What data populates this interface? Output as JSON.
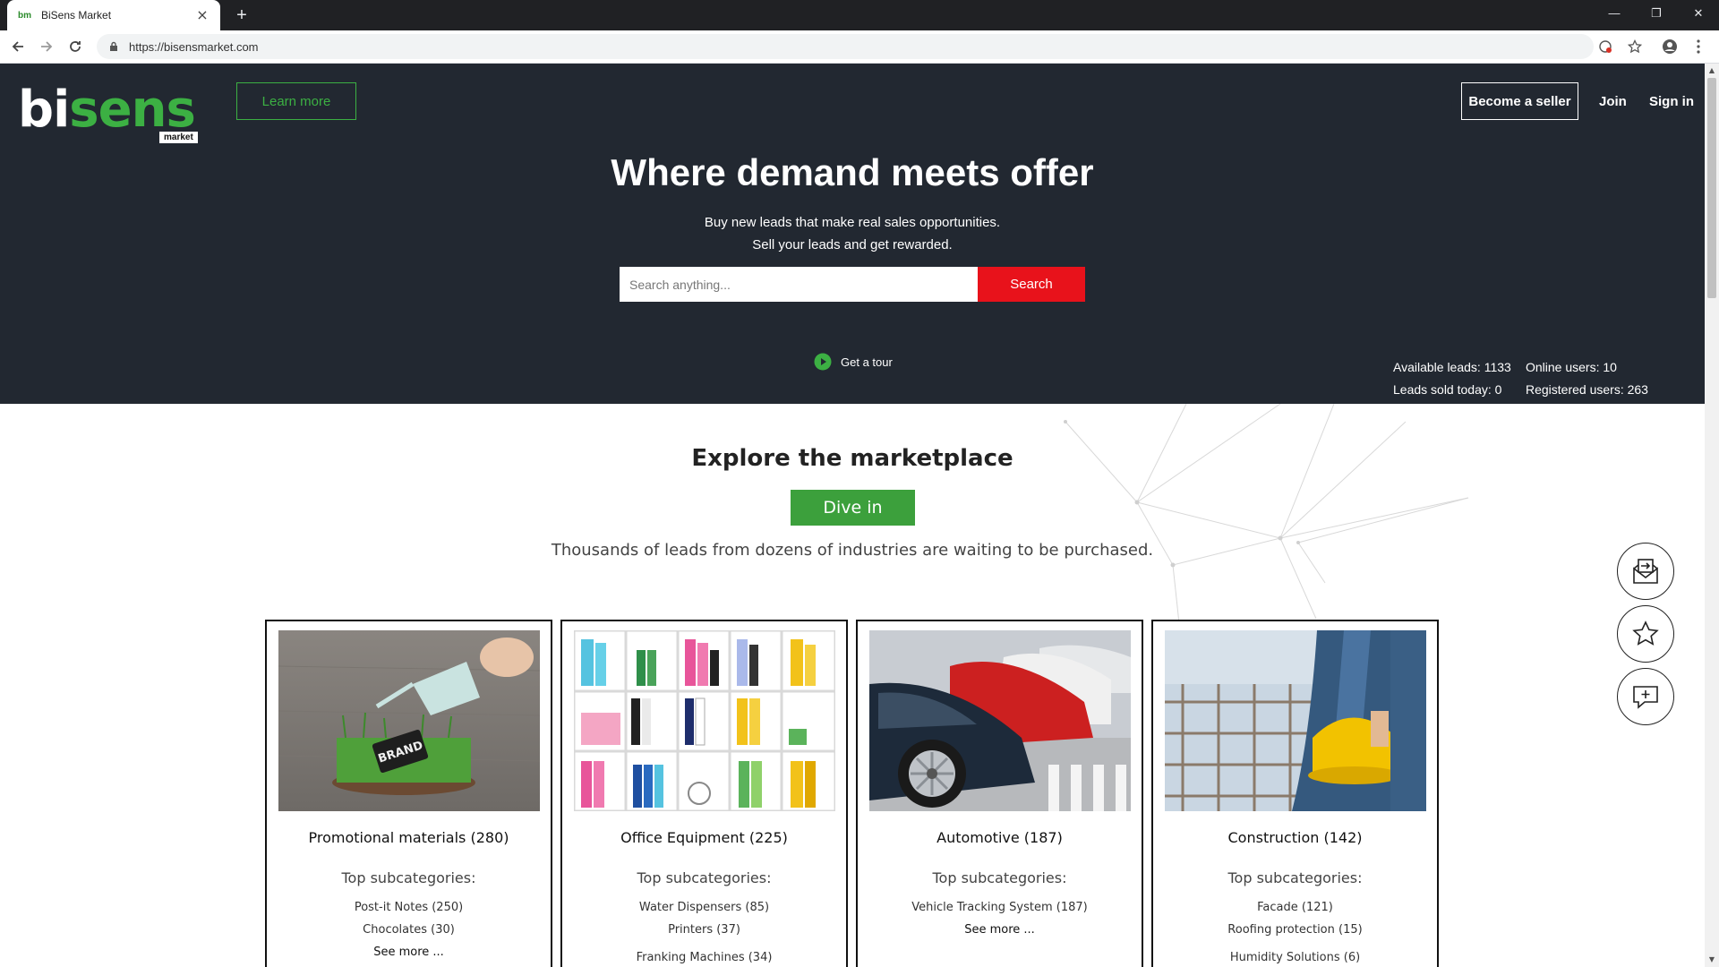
{
  "browser": {
    "tab_title": "BiSens Market",
    "tab_favicon": "bm",
    "url": "https://bisensmarket.com",
    "new_tab_symbol": "+"
  },
  "header": {
    "logo_main_1": "bi",
    "logo_main_2": "sens",
    "logo_sub": "market",
    "learn_more": "Learn more",
    "become_seller": "Become a seller",
    "join": "Join",
    "sign_in": "Sign in"
  },
  "hero": {
    "title": "Where demand meets offer",
    "subtitle_1": "Buy new leads that make real sales opportunities.",
    "subtitle_2": "Sell your leads and get rewarded.",
    "search_placeholder": "Search anything...",
    "search_button": "Search",
    "tour": "Get a tour"
  },
  "stats": {
    "available_leads": "Available leads: 1133",
    "online_users": "Online users: 10",
    "leads_sold_today": "Leads sold today: 0",
    "registered_users": "Registered users: 263"
  },
  "explore": {
    "title": "Explore the marketplace",
    "dive_in": "Dive in",
    "subtitle": "Thousands of leads from dozens of industries are waiting to be purchased."
  },
  "categories": [
    {
      "title": "Promotional materials (280)",
      "subheading": "Top subcategories:",
      "items": [
        "Post-it Notes (250)",
        "Chocolates (30)"
      ],
      "see_more": "See more ..."
    },
    {
      "title": "Office Equipment (225)",
      "subheading": "Top subcategories:",
      "items": [
        "Water Dispensers (85)",
        "Printers (37)",
        "Franking Machines (34)"
      ]
    },
    {
      "title": "Automotive (187)",
      "subheading": "Top subcategories:",
      "items": [
        "Vehicle Tracking System (187)"
      ],
      "see_more": "See more ..."
    },
    {
      "title": "Construction (142)",
      "subheading": "Top subcategories:",
      "items": [
        "Facade (121)",
        "Roofing protection (15)",
        "Humidity Solutions (6)"
      ]
    }
  ],
  "colors": {
    "hero_bg": "#222831",
    "brand_green": "#3cb043",
    "search_red": "#e8121b"
  }
}
